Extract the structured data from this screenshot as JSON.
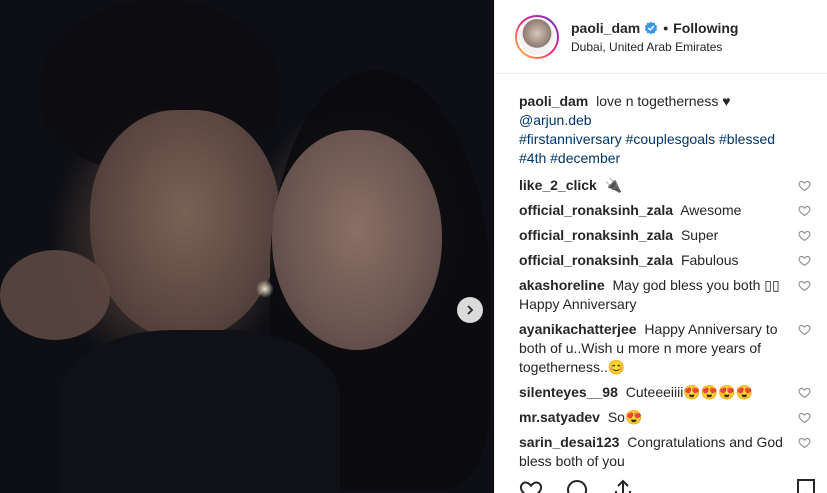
{
  "post": {
    "username": "paoli_dam",
    "follow_separator": "•",
    "follow_label": "Following",
    "location": "Dubai, United Arab Emirates"
  },
  "caption": {
    "username": "paoli_dam",
    "text": "love n togetherness ♥",
    "mention": "@arjun.deb",
    "hashtags_line1": "#firstanniversary #couplesgoals #blessed",
    "hashtags_line2": "#4th #december"
  },
  "comments": [
    {
      "username": "like_2_click",
      "text": "🔌"
    },
    {
      "username": "official_ronaksinh_zala",
      "text": "Awesome"
    },
    {
      "username": "official_ronaksinh_zala",
      "text": "Super"
    },
    {
      "username": "official_ronaksinh_zala",
      "text": "Fabulous"
    },
    {
      "username": "akashoreline",
      "text": "May god bless you both ▯▯ Happy Anniversary"
    },
    {
      "username": "ayanikachatterjee",
      "text": "Happy Anniversary to both of u..Wish u more n more years of togetherness..😊"
    },
    {
      "username": "silenteyes__98",
      "text": "Cuteeeiiii😍😍😍😍"
    },
    {
      "username": "mr.satyadev",
      "text": "So😍"
    },
    {
      "username": "sarin_desai123",
      "text": "Congratulations and God bless both of you"
    }
  ],
  "icons": {
    "verified": "verified-badge-icon",
    "heart": "heart-outline-icon",
    "next": "chevron-right-icon",
    "like": "heart-icon",
    "comment": "comment-icon",
    "share": "share-icon",
    "save": "bookmark-icon"
  },
  "colors": {
    "verified_blue": "#3897f0",
    "hashtag": "#003569",
    "text": "#262626"
  }
}
